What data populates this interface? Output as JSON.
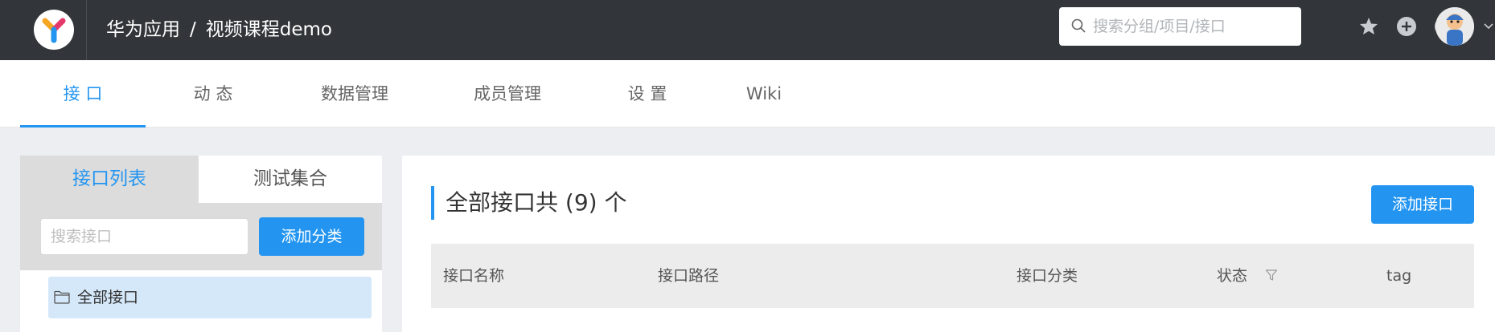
{
  "header": {
    "breadcrumb": [
      "华为应用",
      "视频课程demo"
    ],
    "breadcrumb_separator": "/",
    "search_placeholder": "搜索分组/项目/接口",
    "icons": [
      "star-icon",
      "plus-circle-icon",
      "question-circle-icon"
    ],
    "background": "#32363a"
  },
  "tabs": [
    {
      "label": "接 口",
      "active": true
    },
    {
      "label": "动 态",
      "active": false
    },
    {
      "label": "数据管理",
      "active": false
    },
    {
      "label": "成员管理",
      "active": false
    },
    {
      "label": "设 置",
      "active": false
    },
    {
      "label": "Wiki",
      "active": false
    }
  ],
  "sidebar": {
    "tabs": [
      {
        "label": "接口列表",
        "active": true
      },
      {
        "label": "测试集合",
        "active": false
      }
    ],
    "search_placeholder": "搜索接口",
    "add_category_label": "添加分类",
    "tree": [
      {
        "label": "全部接口",
        "selected": true,
        "icon": "folder-icon"
      }
    ]
  },
  "main": {
    "title": "全部接口共 (9) 个",
    "add_button_label": "添加接口",
    "columns": [
      "接口名称",
      "接口路径",
      "接口分类",
      "状态",
      "tag"
    ]
  },
  "colors": {
    "accent": "#2395f1",
    "selected_row": "#d5e8f9"
  }
}
